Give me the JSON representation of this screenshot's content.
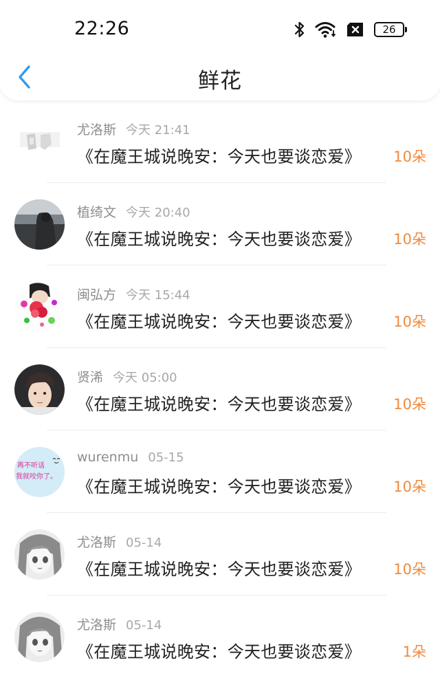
{
  "status_bar": {
    "time": "22:26",
    "battery_level": "26",
    "icons": [
      "bluetooth-icon",
      "wifi-icon",
      "sim-disabled-icon",
      "battery-icon"
    ]
  },
  "nav": {
    "back_icon": "chevron-left-icon",
    "title": "鲜花"
  },
  "colors": {
    "accent_blue": "#2f9bf0",
    "flower_orange": "#f08a3e",
    "name_gray": "#8e8e8e",
    "time_gray": "#a8a8a8"
  },
  "items": [
    {
      "user": "尤洛斯",
      "time": "今天 21:41",
      "book": "《在魔王城说晚安：今天也要谈恋爱》",
      "count": "10朵"
    },
    {
      "user": "植绮文",
      "time": "今天 20:40",
      "book": "《在魔王城说晚安：今天也要谈恋爱》",
      "count": "10朵"
    },
    {
      "user": "闽弘方",
      "time": "今天 15:44",
      "book": "《在魔王城说晚安：今天也要谈恋爱》",
      "count": "10朵"
    },
    {
      "user": "贤浠",
      "time": "今天 05:00",
      "book": "《在魔王城说晚安：今天也要谈恋爱》",
      "count": "10朵"
    },
    {
      "user": "wurenmu",
      "time": "05-15",
      "book": "《在魔王城说晚安：今天也要谈恋爱》",
      "count": "10朵",
      "avatar_text_1": "再不听话",
      "avatar_text_2": "我就咬你了。"
    },
    {
      "user": "尤洛斯",
      "time": "05-14",
      "book": "《在魔王城说晚安：今天也要谈恋爱》",
      "count": "10朵"
    },
    {
      "user": "尤洛斯",
      "time": "05-14",
      "book": "《在魔王城说晚安：今天也要谈恋爱》",
      "count": "1朵"
    }
  ]
}
